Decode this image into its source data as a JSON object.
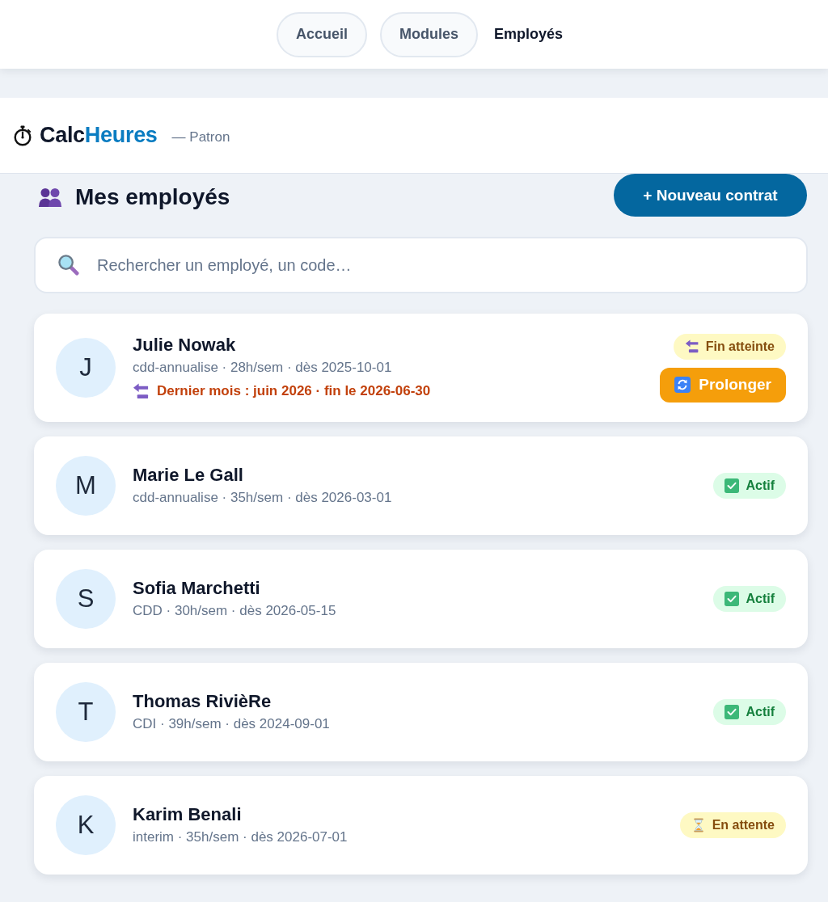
{
  "nav": {
    "tabs": [
      {
        "label": "Accueil",
        "selected": false
      },
      {
        "label": "Modules",
        "selected": false
      },
      {
        "label": "Employés",
        "selected": true
      }
    ]
  },
  "header": {
    "brand": [
      {
        "text": "Calc",
        "kind": "plain"
      },
      {
        "text": "Heures",
        "kind": "accent"
      }
    ],
    "role": "— Patron"
  },
  "page": {
    "title": "Mes employés",
    "new_button": "+ Nouveau contrat"
  },
  "search": {
    "placeholder": "Rechercher un employé, un code…"
  },
  "employees": [
    {
      "initial": "J",
      "name": "Julie Nowak",
      "details": "cdd-annualise · 28h/sem · dès 2025-10-01",
      "warning": "Dernier mois : juin 2026 · fin le 2026-06-30",
      "status": {
        "kind": "ended",
        "label": "Fin atteinte"
      },
      "action": "Prolonger"
    },
    {
      "initial": "M",
      "name": "Marie Le Gall",
      "details": "cdd-annualise · 35h/sem · dès 2026-03-01",
      "status": {
        "kind": "active",
        "label": "Actif"
      }
    },
    {
      "initial": "S",
      "name": "Sofia Marchetti",
      "details": "CDD · 30h/sem · dès 2026-05-15",
      "status": {
        "kind": "active",
        "label": "Actif"
      }
    },
    {
      "initial": "T",
      "name": "Thomas RivièRe",
      "details": "CDI · 39h/sem · dès 2024-09-01",
      "status": {
        "kind": "active",
        "label": "Actif"
      }
    },
    {
      "initial": "K",
      "name": "Karim Benali",
      "details": "interim · 35h/sem · dès 2026-07-01",
      "status": {
        "kind": "pending",
        "label": "En attente"
      }
    }
  ]
}
